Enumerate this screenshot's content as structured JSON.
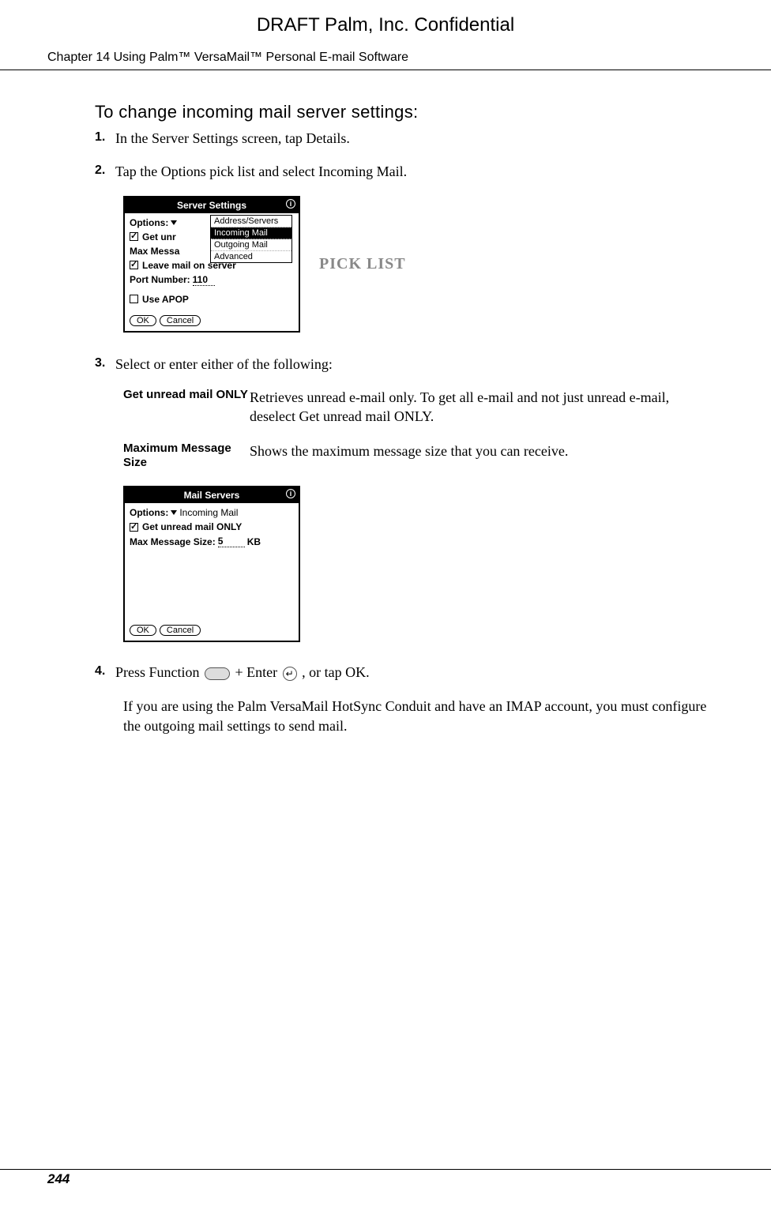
{
  "header": {
    "draft": "DRAFT   Palm, Inc. Confidential",
    "chapter": "Chapter 14    Using Palm™ VersaMail™ Personal E-mail Software"
  },
  "section_title": "To change incoming mail server settings:",
  "steps": {
    "s1": {
      "num": "1.",
      "text": "In the Server Settings screen, tap Details."
    },
    "s2": {
      "num": "2.",
      "text": "Tap the Options pick list and select Incoming Mail."
    },
    "s3": {
      "num": "3.",
      "text": "Select or enter either of the following:"
    },
    "s4": {
      "num": "4.",
      "text_a": "Press Function ",
      "text_b": " + Enter ",
      "text_c": ", or tap OK."
    }
  },
  "callout": "PICK LIST",
  "screenshot1": {
    "title": "Server Settings",
    "options_label": "Options:",
    "dropdown": {
      "opt1": "Address/Servers",
      "opt2": "Incoming Mail",
      "opt3": "Outgoing Mail",
      "opt4": "Advanced"
    },
    "line_getunr": "Get unr",
    "line_maxmsg": "Max Messa",
    "line_leave": "Leave mail on server",
    "line_port_label": "Port Number:",
    "line_port_val": "110",
    "line_apop": "Use APOP",
    "btn_ok": "OK",
    "btn_cancel": "Cancel"
  },
  "defs": {
    "d1": {
      "term": "Get unread mail ONLY",
      "desc": "Retrieves unread e-mail only. To get all e-mail and not just unread e-mail, deselect Get unread mail ONLY."
    },
    "d2": {
      "term": "Maximum Message Size",
      "desc": "Shows the maximum message size that you can receive."
    }
  },
  "screenshot2": {
    "title": "Mail Servers",
    "options_label": "Options:",
    "options_val": "Incoming Mail",
    "line_getunr": "Get unread mail ONLY",
    "line_maxsize_label": "Max Message Size:",
    "line_maxsize_val": "5",
    "line_maxsize_unit": "KB",
    "btn_ok": "OK",
    "btn_cancel": "Cancel"
  },
  "after_step4": "If you are using the Palm VersaMail HotSync Conduit and have an IMAP account, you must configure the outgoing mail settings to send mail.",
  "footer": {
    "page": "244"
  },
  "enter_glyph": "↵"
}
